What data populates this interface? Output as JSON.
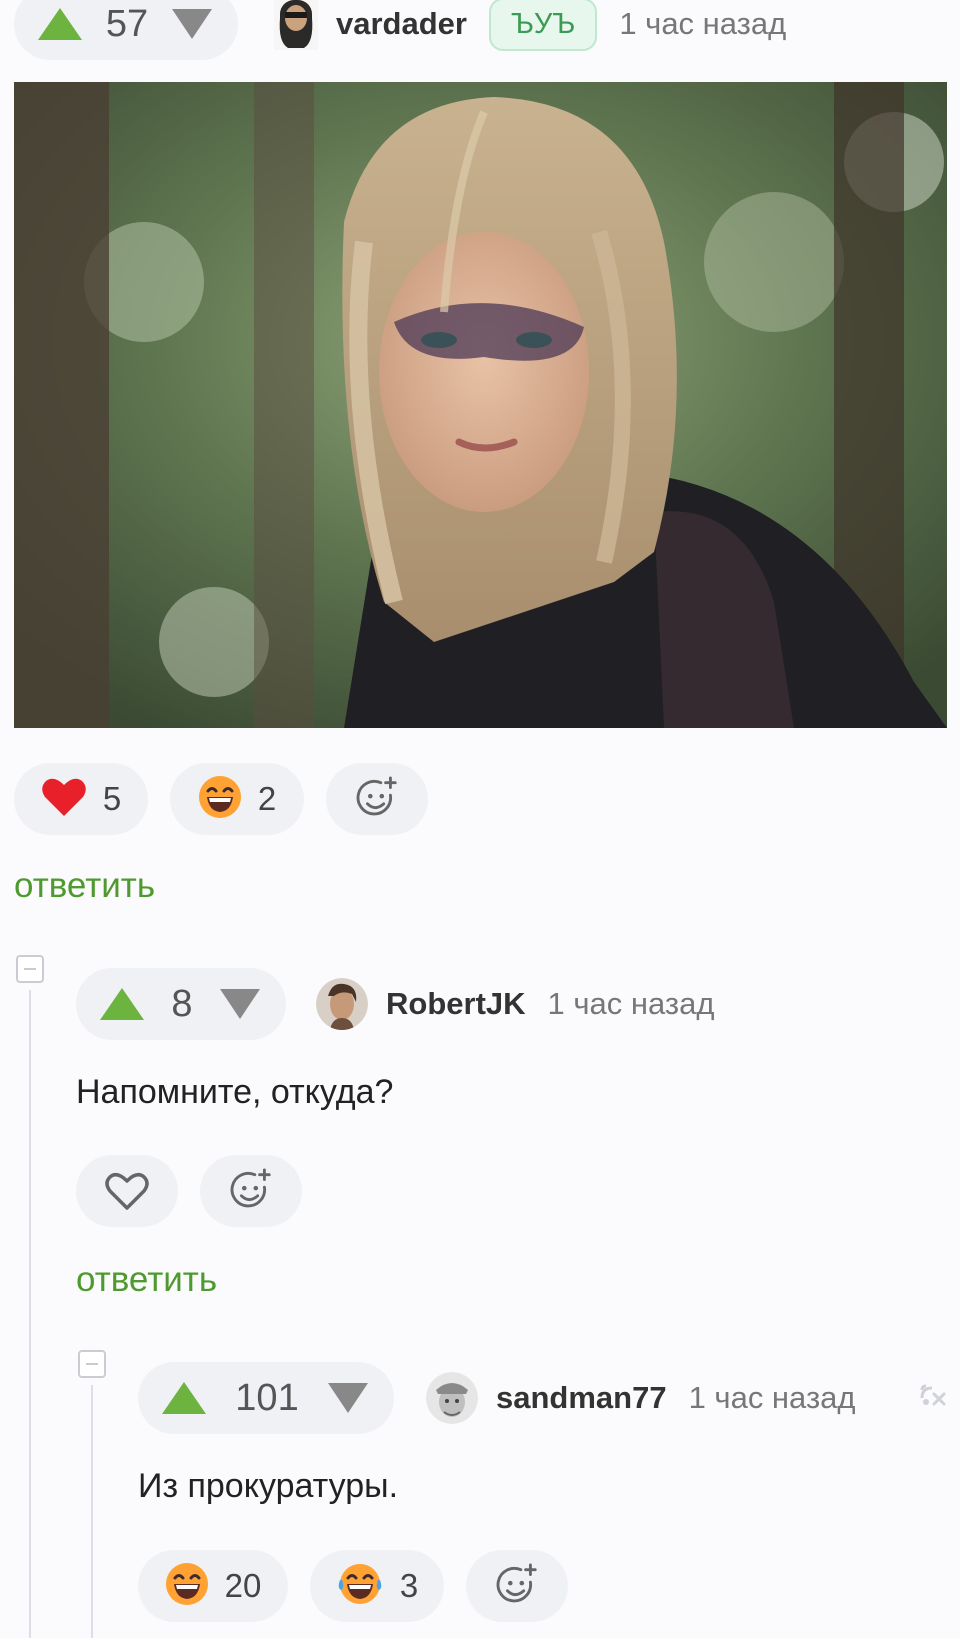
{
  "post": {
    "vote_count": "57",
    "username": "vardader",
    "badge": "ЪУЪ",
    "time": "1 час назад",
    "reactions": [
      {
        "icon": "heart-icon",
        "count": "5"
      },
      {
        "icon": "grinning-face-icon",
        "count": "2"
      }
    ],
    "reply_label": "ответить"
  },
  "comment1": {
    "vote_count": "8",
    "username": "RobertJK",
    "time": "1 час назад",
    "text": "Напомните, откуда?",
    "reply_label": "ответить"
  },
  "comment2": {
    "vote_count": "101",
    "username": "sandman77",
    "time": "1 час назад",
    "text": "Из прокуратуры.",
    "reactions": [
      {
        "icon": "grinning-face-icon",
        "count": "20"
      },
      {
        "icon": "tears-of-joy-icon",
        "count": "3"
      }
    ]
  },
  "colors": {
    "upvote": "#6db33f",
    "reply_link": "#4e9a2e",
    "heart": "#e8202a"
  }
}
